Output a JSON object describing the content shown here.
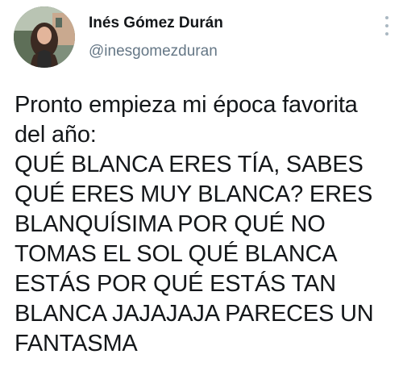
{
  "tweet": {
    "author": {
      "display_name": "Inés Gómez Durán",
      "handle": "@inesgomezduran",
      "avatar_icon": "profile-photo"
    },
    "more_icon": "vertical-ellipsis-icon",
    "text": "Pronto empieza mi época favorita\ndel año:\nQUÉ BLANCA ERES TÍA, SABES\nQUÉ ERES MUY BLANCA? ERES\nBLANQUÍSIMA POR QUÉ NO\nTOMAS EL SOL QUÉ BLANCA\nESTÁS POR QUÉ ESTÁS TAN\nBLANCA JAJAJAJA PARECES UN\nFANTASMA"
  },
  "colors": {
    "text": "#14171a",
    "secondary": "#657786",
    "icon": "#aab8c2",
    "background": "#ffffff"
  }
}
